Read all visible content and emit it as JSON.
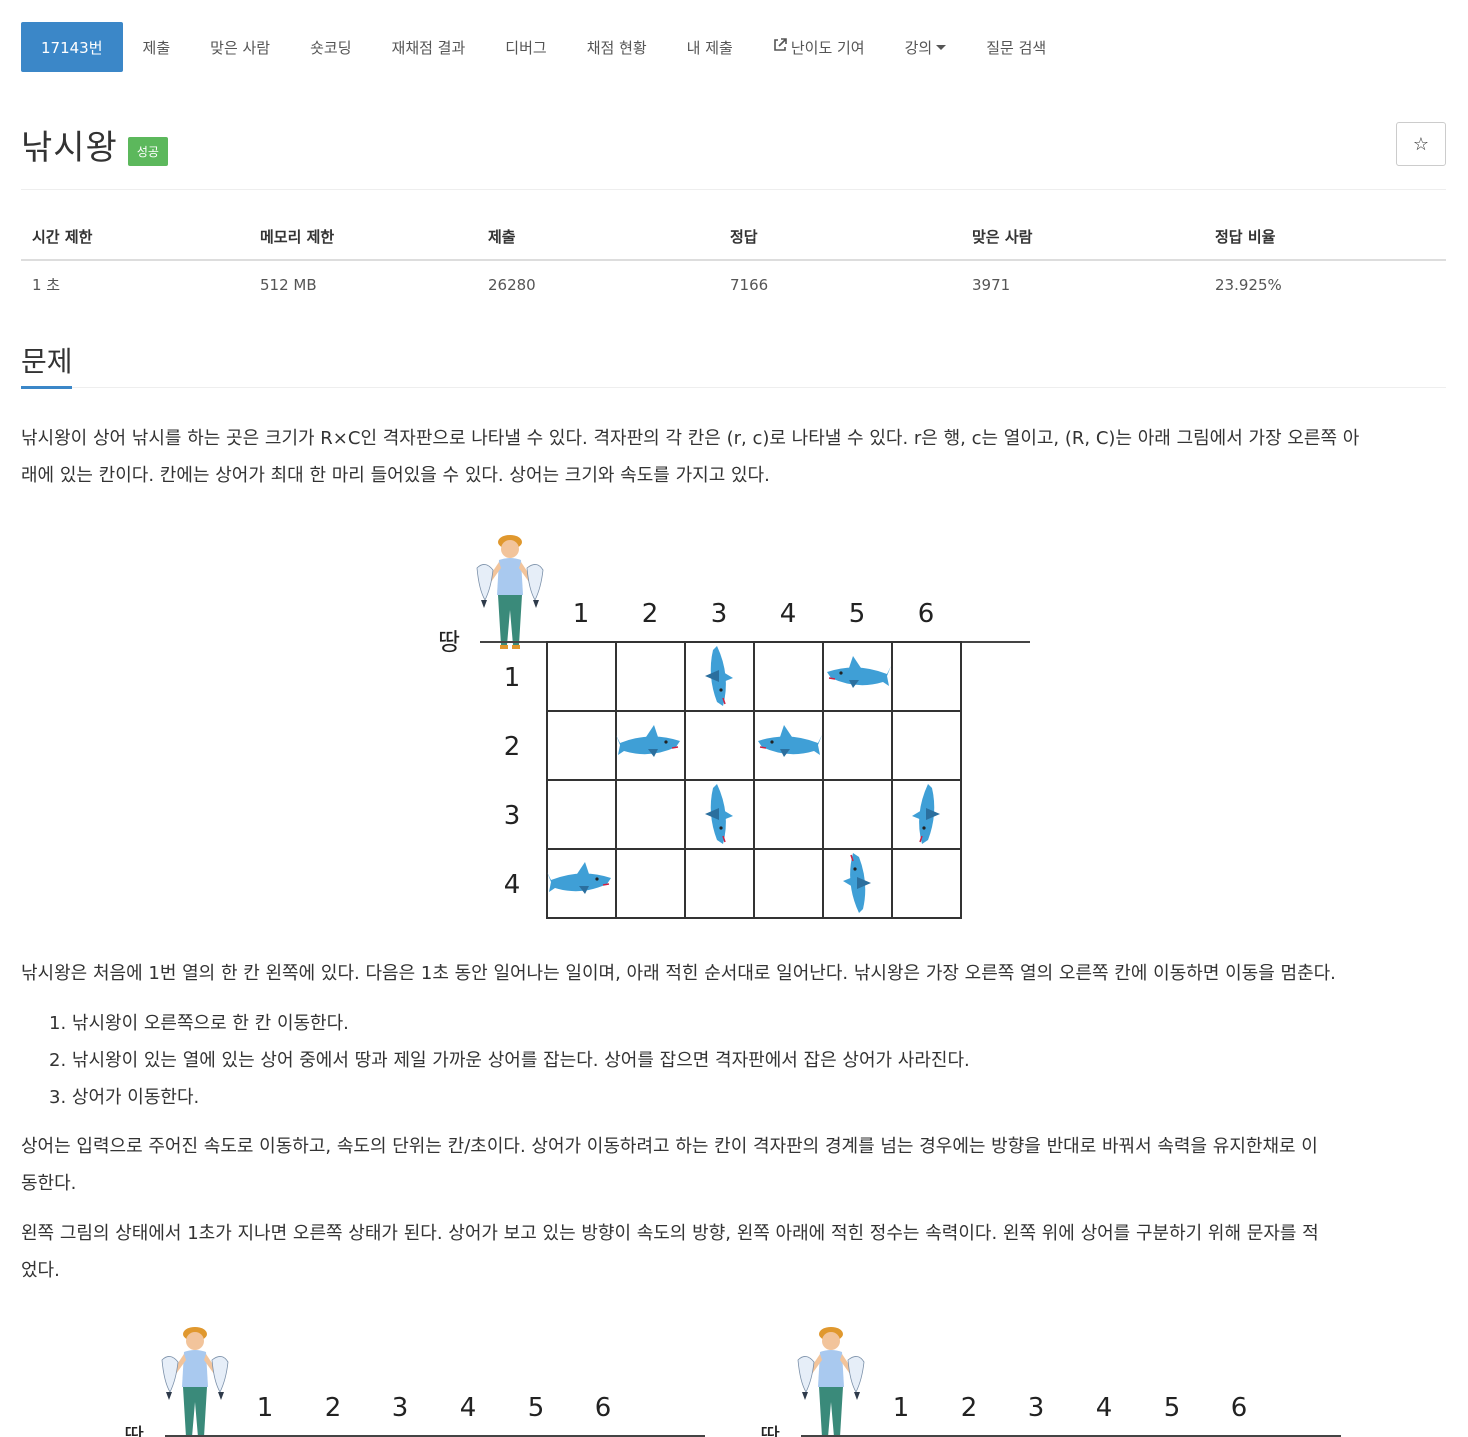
{
  "nav": {
    "items": [
      {
        "label": "17143번",
        "active": true
      },
      {
        "label": "제출"
      },
      {
        "label": "맞은 사람"
      },
      {
        "label": "숏코딩"
      },
      {
        "label": "재채점 결과"
      },
      {
        "label": "디버그"
      },
      {
        "label": "채점 현황"
      },
      {
        "label": "내 제출"
      },
      {
        "label": "난이도 기여",
        "icon": "external-link-icon"
      },
      {
        "label": "강의",
        "dropdown": true
      },
      {
        "label": "질문 검색"
      }
    ]
  },
  "problem": {
    "title": "낚시왕",
    "status_badge": "성공",
    "star_icon": "☆"
  },
  "info": {
    "headers": [
      "시간 제한",
      "메모리 제한",
      "제출",
      "정답",
      "맞은 사람",
      "정답 비율"
    ],
    "values": [
      "1 초",
      "512 MB",
      "26280",
      "7166",
      "3971",
      "23.925%"
    ]
  },
  "section": {
    "heading": "문제"
  },
  "body": {
    "p1_line1": "낚시왕이 상어 낚시를 하는 곳은 크기가 R×C인 격자판으로 나타낼 수 있다. 격자판의 각 칸은 (r, c)로 나타낼 수 있다. r은 행, c는 열이고, (R, C)는 아래 그림에서 가장 오른쪽 아",
    "p1_line2": "래에 있는 칸이다. 칸에는 상어가 최대 한 마리 들어있을 수 있다. 상어는 크기와 속도를 가지고 있다.",
    "p2": "낚시왕은 처음에 1번 열의 한 칸 왼쪽에 있다. 다음은 1초 동안 일어나는 일이며, 아래 적힌 순서대로 일어난다. 낚시왕은 가장 오른쪽 열의 오른쪽 칸에 이동하면 이동을 멈춘다.",
    "steps": [
      "1. 낚시왕이 오른쪽으로 한 칸 이동한다.",
      "2. 낚시왕이 있는 열에 있는 상어 중에서 땅과 제일 가까운 상어를 잡는다. 상어를 잡으면 격자판에서 잡은 상어가 사라진다.",
      "3. 상어가 이동한다."
    ],
    "p3_line1": "상어는 입력으로 주어진 속도로 이동하고, 속도의 단위는 칸/초이다. 상어가 이동하려고 하는 칸이 격자판의 경계를 넘는 경우에는 방향을 반대로 바꿔서 속력을 유지한채로 이",
    "p3_line2": "동한다.",
    "p4_line1": "왼쪽 그림의 상태에서 1초가 지나면 오른쪽 상태가 된다. 상어가 보고 있는 방향이 속도의 방향, 왼쪽 아래에 적힌 정수는 속력이다. 왼쪽 위에 상어를 구분하기 위해 문자를 적",
    "p4_line2": "었다."
  },
  "figure1": {
    "ground_label": "땅",
    "col_labels": [
      "1",
      "2",
      "3",
      "4",
      "5",
      "6"
    ],
    "row_labels": [
      "1",
      "2",
      "3",
      "4"
    ]
  },
  "figure2": {
    "ground_label": "땅",
    "col_labels": [
      "1",
      "2",
      "3",
      "4",
      "5",
      "6"
    ]
  },
  "figure3": {
    "ground_label": "땅",
    "col_labels": [
      "1",
      "2",
      "3",
      "4",
      "5",
      "6"
    ]
  },
  "colors": {
    "accent": "#3b87c8",
    "success": "#5cb85c",
    "shark": "#3f9fd6",
    "shirt": "#a9c9ef",
    "pants": "#3a8a7a",
    "hair": "#e0982e"
  }
}
